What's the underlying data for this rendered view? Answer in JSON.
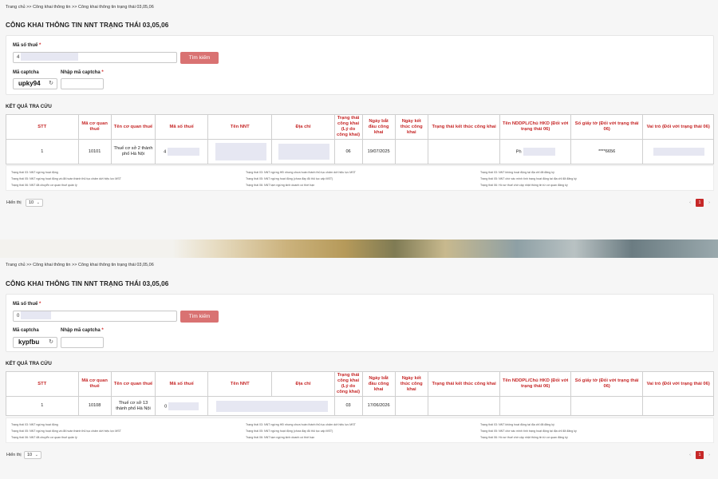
{
  "breadcrumb": [
    "Trang chủ",
    ">>",
    "Công khai thông tin",
    ">>",
    "Công khai thông tin trạng thái 03,05,06"
  ],
  "page_title": "CÔNG KHAI THÔNG TIN NNT TRẠNG THÁI 03,05,06",
  "form": {
    "tax_code_label": "Mã số thuế",
    "captcha_label": "Mã captcha",
    "captcha_input_label": "Nhập mã captcha",
    "required_mark": "*",
    "search_button": "Tìm kiếm",
    "refresh_icon": "refresh-icon"
  },
  "results_label": "KẾT QUẢ TRA CỨU",
  "table": {
    "headers": [
      "STT",
      "Mã cơ quan thuế",
      "Tên cơ quan thuế",
      "Mã số thuế",
      "Tên NNT",
      "Địa chỉ",
      "Trạng thái công khai (Lý do công khai)",
      "Ngày bắt đầu công khai",
      "Ngày kết thúc công khai",
      "Trạng thái kết thúc công khai",
      "Tên NDDPL/Chủ HKD (Đối với trạng thái 06)",
      "Số giấy tờ (Đối với trạng thái 06)",
      "Vai trò (Đối với trạng thái 06)"
    ]
  },
  "legend": {
    "col1": [
      "Trạng thái 03: NNT ngừng hoạt động",
      "Trạng thái 05: NNT ngừng hoạt động và đã hoàn thành thủ tục chấm dứt hiệu lực MST",
      "Trạng thái 06: NNT đã chuyển cơ quan thuế quản lý"
    ],
    "col2": [
      "Trạng thái 03: NNT ngừng HĐ nhưng chưa hoàn thành thủ tục chấm dứt hiệu lực MST",
      "Trạng thái 05: NNT ngừng hoạt động (chưa đầy đủ thủ tục cấp MST)",
      "Trạng thái 06: NNT tạm ngừng kinh doanh có thời hạn"
    ],
    "col3": [
      "Trạng thái 03: NNT không hoạt động tại địa chỉ đã đăng ký",
      "Trạng thái 05: NNT chờ xác minh tình trạng hoạt động tại địa chỉ đã đăng ký",
      "Trạng thái 06: Hồ sơ thuế chờ cập nhật thông tin từ cơ quan đăng ký"
    ]
  },
  "footer": {
    "show_label": "Hiển thị",
    "page_size": "10",
    "prev": "‹",
    "page": "1",
    "next": "›"
  },
  "panels": [
    {
      "tax_code_value": "4",
      "captcha_text": "upky94",
      "row": {
        "stt": "1",
        "ma_cqt": "10101",
        "ten_cqt": "Thuế cơ sở 2 thành phố Hà Nội",
        "mst": "4",
        "ten_nnt": "",
        "dia_chi": "",
        "trang_thai": "06",
        "ngay_bd": "19/07/2025",
        "ngay_kt": "",
        "tt_kt": "",
        "nddpl": "Ph",
        "so_giay_to": "****6656",
        "vai_tro": ""
      }
    },
    {
      "tax_code_value": "0",
      "captcha_text": "kypfbu",
      "row": {
        "stt": "1",
        "ma_cqt": "10108",
        "ten_cqt": "Thuế cơ sở 13 thành phố Hà Nội",
        "mst": "0",
        "ten_nnt": "",
        "dia_chi": "",
        "trang_thai": "03",
        "ngay_bd": "17/06/2026",
        "ngay_kt": "",
        "tt_kt": "",
        "nddpl": "",
        "so_giay_to": "",
        "vai_tro": ""
      }
    }
  ],
  "colors": {
    "accent": "#c62828",
    "button": "#d97272",
    "mask": "#e6e7f2"
  }
}
